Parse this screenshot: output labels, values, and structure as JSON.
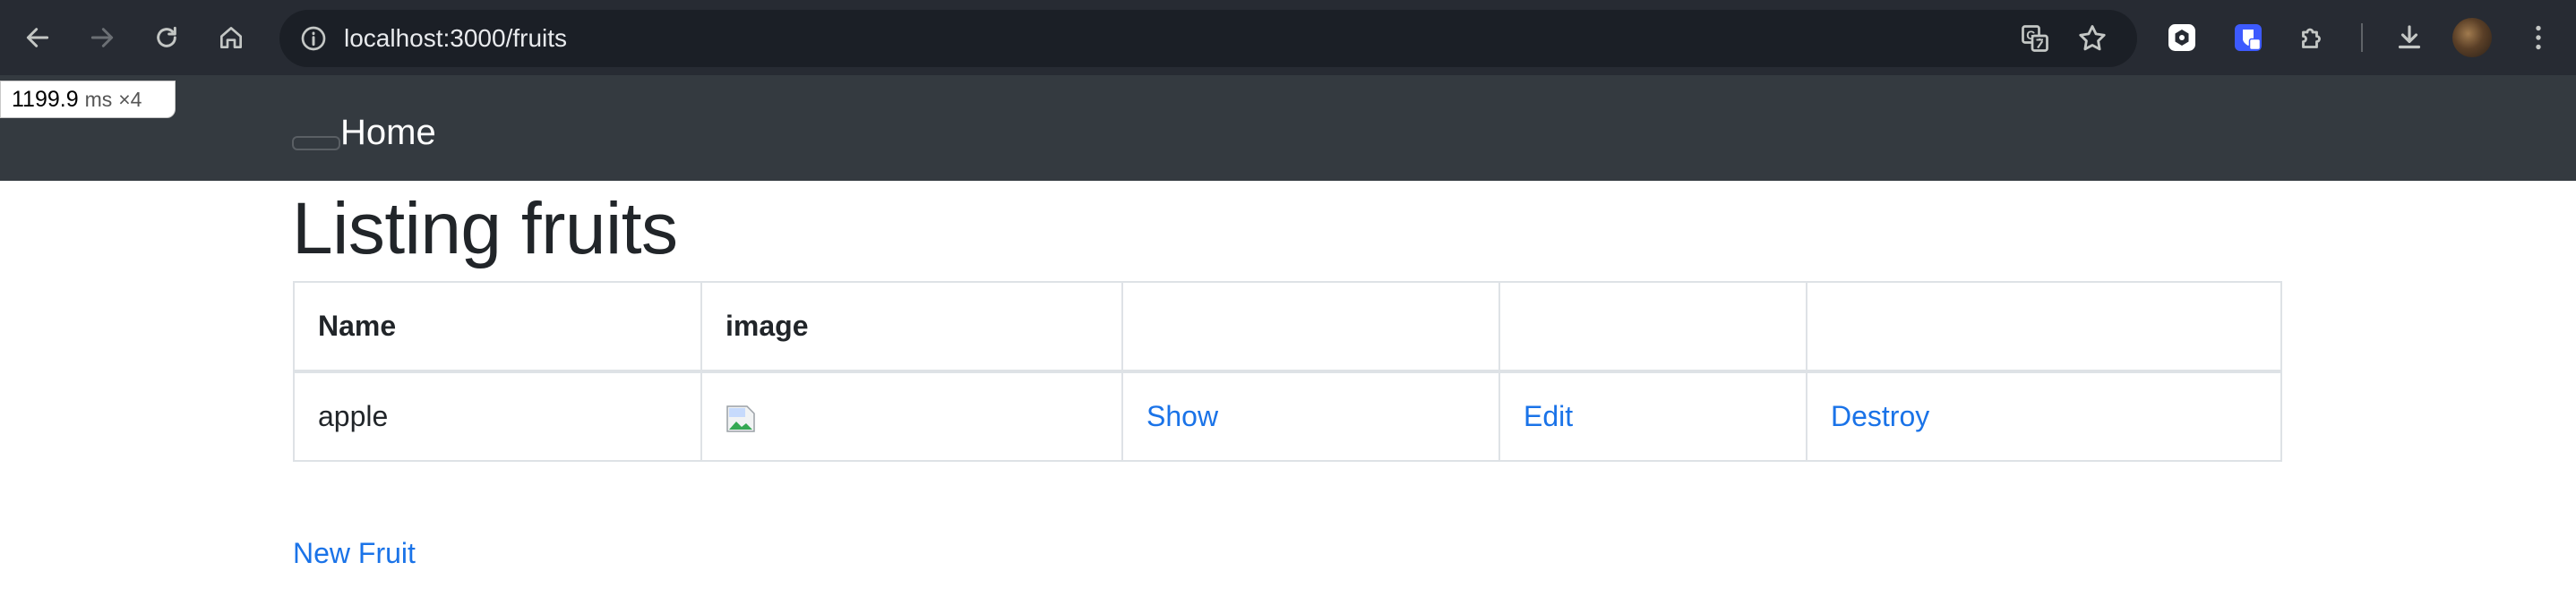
{
  "browser": {
    "url": "localhost:3000/fruits",
    "icons": {
      "back": "arrow-left-icon",
      "forward": "arrow-right-icon",
      "reload": "reload-icon",
      "home": "home-icon",
      "info": "info-icon",
      "translate": "translate-icon",
      "bookmark": "star-icon",
      "ext1": "extension-icon",
      "ext2": "shield-extension-icon",
      "extensions": "puzzle-icon",
      "download": "download-icon",
      "menu": "kebab-menu-icon"
    }
  },
  "perf_badge": {
    "value": "1199.9",
    "unit": "ms",
    "multiplier": "×4"
  },
  "navbar": {
    "brand": "Home"
  },
  "page": {
    "title": "Listing fruits",
    "table": {
      "headers": [
        "Name",
        "image",
        "",
        "",
        ""
      ],
      "rows": [
        {
          "name": "apple",
          "show": "Show",
          "edit": "Edit",
          "destroy": "Destroy"
        }
      ]
    },
    "new_link": "New Fruit"
  },
  "colors": {
    "chrome_bg": "#272b33",
    "navbar_bg": "#343a40",
    "link": "#1a73e8",
    "text": "#212529"
  }
}
